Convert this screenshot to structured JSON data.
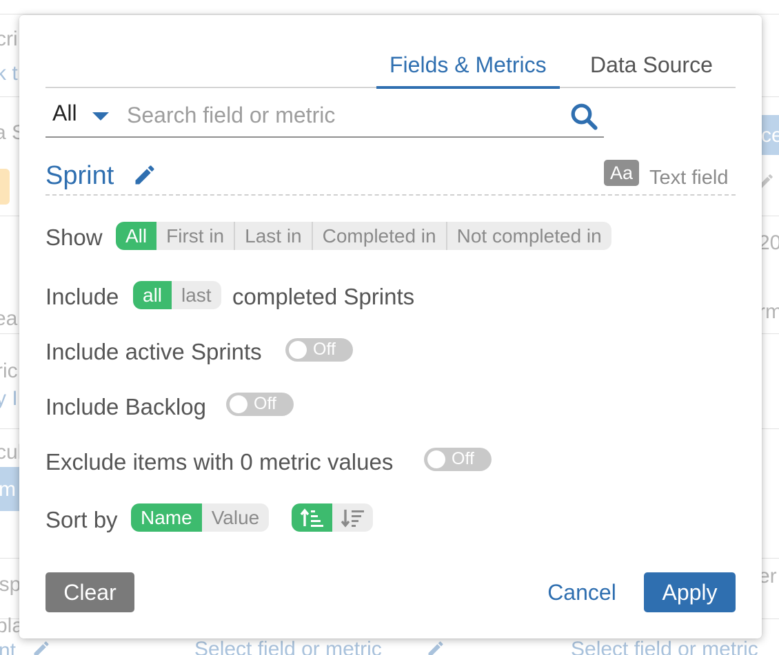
{
  "background": {
    "fragments_left": [
      "cri",
      "k t",
      "a S",
      "ea",
      "ric",
      "y I",
      "cul",
      "m",
      "isp",
      "pla",
      "nt"
    ],
    "fragments_right": [
      "ce",
      "20",
      "rm",
      "er"
    ],
    "bottom_placeholder_1": "Select field or metric",
    "bottom_placeholder_2": "Select field or metric"
  },
  "modal": {
    "tabs": [
      {
        "label": "Fields & Metrics",
        "active": true
      },
      {
        "label": "Data Source",
        "active": false
      }
    ],
    "search": {
      "scope_value": "All",
      "placeholder": "Search field or metric",
      "value": ""
    },
    "field": {
      "name": "Sprint",
      "type_badge": "Aa",
      "type_label": "Text field"
    },
    "show": {
      "label": "Show",
      "options": [
        "All",
        "First in",
        "Last in",
        "Completed in",
        "Not completed in"
      ],
      "selected": "All"
    },
    "include": {
      "label": "Include",
      "options": [
        "all",
        "last"
      ],
      "selected": "all",
      "suffix": "completed Sprints"
    },
    "include_active": {
      "label": "Include active Sprints",
      "toggle": "Off"
    },
    "include_backlog": {
      "label": "Include Backlog",
      "toggle": "Off"
    },
    "exclude_zero": {
      "label": "Exclude items with 0 metric values",
      "toggle": "Off"
    },
    "sort": {
      "label": "Sort by",
      "options": [
        "Name",
        "Value"
      ],
      "selected": "Name",
      "direction": "ascending"
    },
    "buttons": {
      "clear": "Clear",
      "cancel": "Cancel",
      "apply": "Apply"
    }
  },
  "colors": {
    "primary": "#2f6fb0",
    "green": "#3dbb6e",
    "toggle_off": "#c9c9c9",
    "clear_button": "#7a7a7a"
  }
}
